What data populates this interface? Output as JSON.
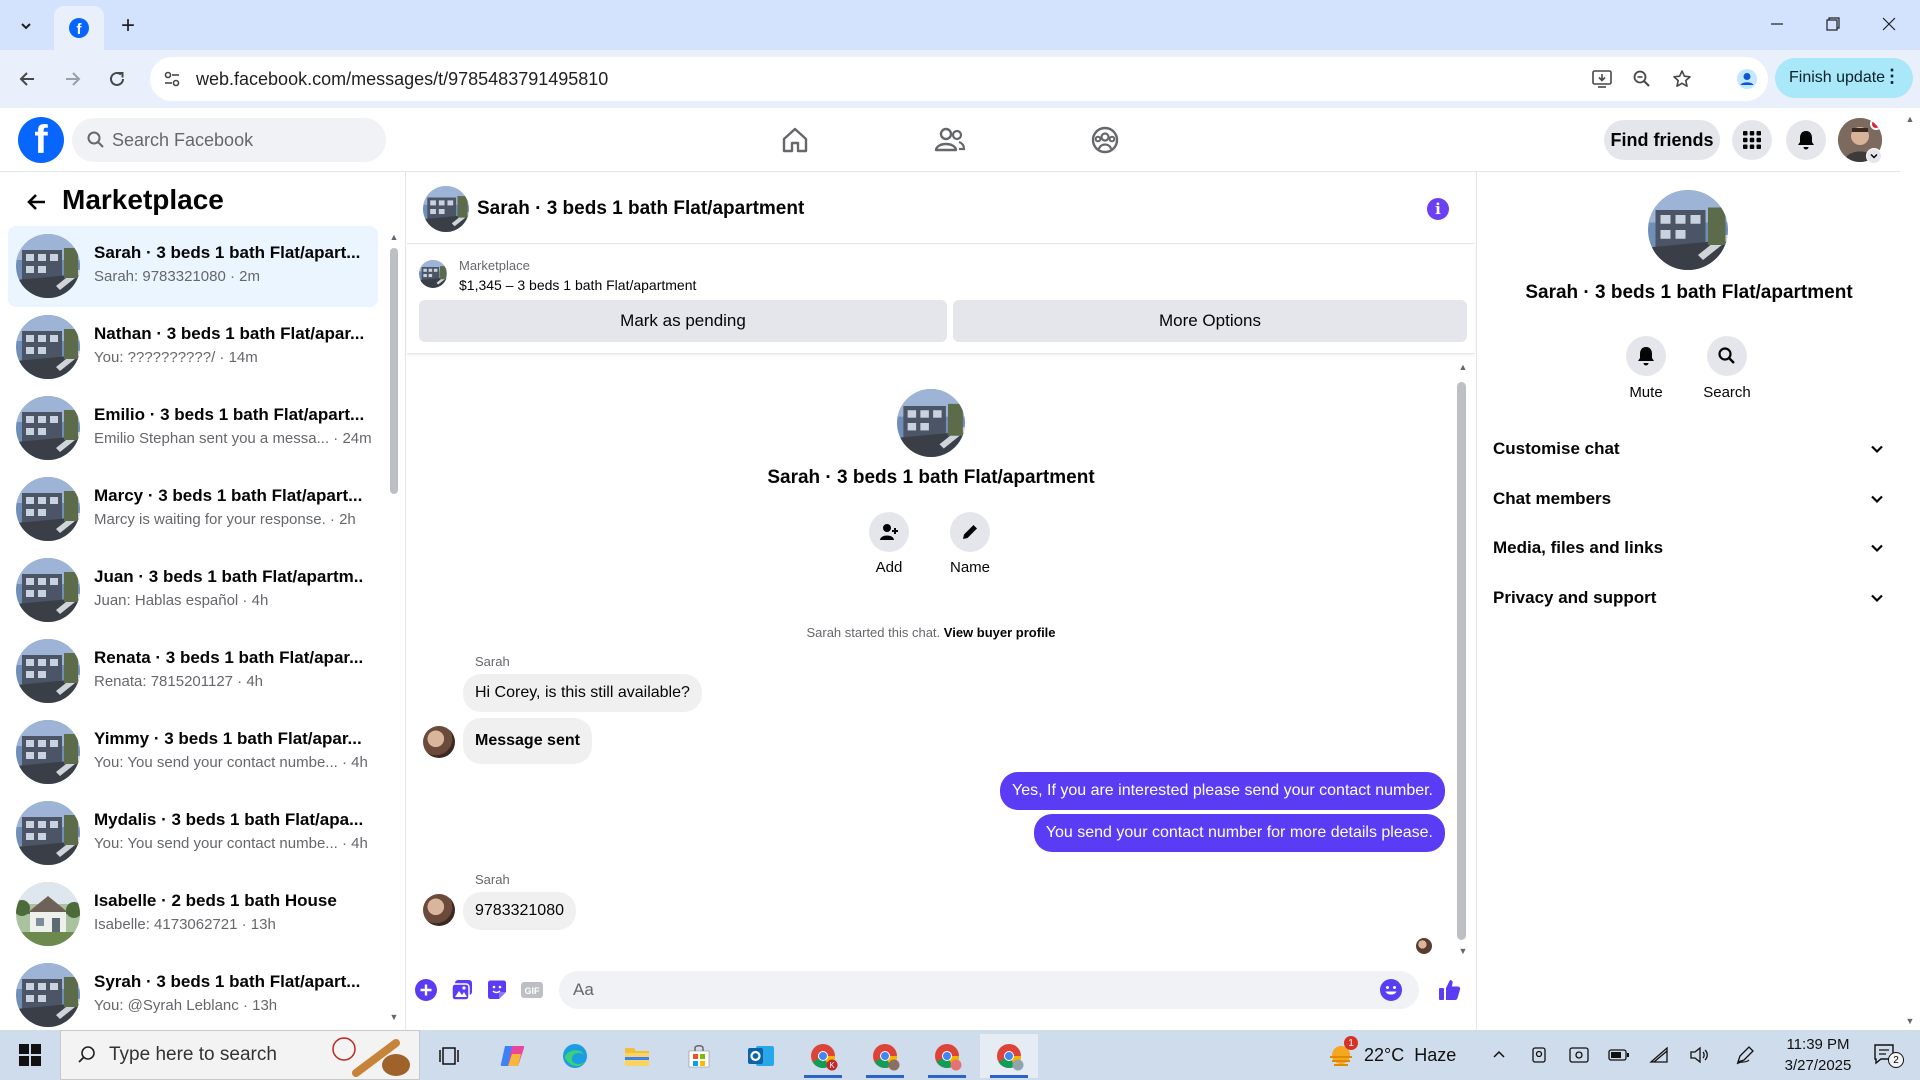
{
  "browser": {
    "url": "web.facebook.com/messages/t/9785483791495810",
    "finish_update": "Finish update",
    "colors": {
      "tabbar": "#d3e3fd",
      "toolbar": "#e9f0fb",
      "update_pill": "#a8e8f8"
    }
  },
  "fb_header": {
    "search_placeholder": "Search Facebook",
    "find_friends": "Find friends",
    "brand_color": "#0866ff"
  },
  "left_panel": {
    "title": "Marketplace",
    "chats": [
      {
        "title": "Sarah · 3 beds 1 bath Flat/apart...",
        "subtitle": "Sarah: 9783321080 · 2m",
        "thumb": "building"
      },
      {
        "title": "Nathan · 3 beds 1 bath Flat/apar...",
        "subtitle": "You: ??????????/ · 14m",
        "thumb": "building"
      },
      {
        "title": "Emilio · 3 beds 1 bath Flat/apart...",
        "subtitle": "Emilio Stephan sent you a messa... · 24m",
        "thumb": "building"
      },
      {
        "title": "Marcy · 3 beds 1 bath Flat/apart...",
        "subtitle": "Marcy is waiting for your response. · 2h",
        "thumb": "building"
      },
      {
        "title": "Juan · 3 beds 1 bath Flat/apartm...",
        "subtitle": "Juan: Hablas español · 4h",
        "thumb": "building"
      },
      {
        "title": "Renata · 3 beds 1 bath Flat/apar...",
        "subtitle": "Renata: 7815201127 · 4h",
        "thumb": "building"
      },
      {
        "title": "Yimmy · 3 beds 1 bath Flat/apar...",
        "subtitle": "You: You send your contact numbe... · 4h",
        "thumb": "building"
      },
      {
        "title": "Mydalis · 3 beds 1 bath Flat/apa...",
        "subtitle": "You: You send your contact numbe... · 4h",
        "thumb": "building"
      },
      {
        "title": "Isabelle · 2 beds 1 bath House",
        "subtitle": "Isabelle: 4173062721 · 13h",
        "thumb": "house"
      },
      {
        "title": "Syrah · 3 beds 1 bath Flat/apart...",
        "subtitle": "You: @Syrah Leblanc · 13h",
        "thumb": "building"
      }
    ]
  },
  "conversation": {
    "title": "Sarah · 3 beds 1 bath Flat/apartment",
    "listing_source": "Marketplace",
    "listing_detail": "$1,345 – 3 beds 1 bath Flat/apartment",
    "mark_pending": "Mark as pending",
    "more_options": "More Options",
    "intro_title": "Sarah · 3 beds 1 bath Flat/apartment",
    "add_label": "Add",
    "name_label": "Name",
    "started_prefix": "Sarah started this chat.",
    "view_buyer": "View buyer profile",
    "messages": [
      {
        "sender": "Sarah",
        "text": "Hi Corey, is this still available?",
        "dir": "in"
      },
      {
        "sender": "",
        "text": "Message sent",
        "dir": "in"
      },
      {
        "sender": "",
        "text": "Yes, If you are interested please send your contact number.",
        "dir": "out"
      },
      {
        "sender": "",
        "text": "You send your contact number for more details please.",
        "dir": "out"
      },
      {
        "sender": "Sarah",
        "text": "9783321080",
        "dir": "in"
      }
    ],
    "composer_placeholder": "Aa",
    "accent": "#5b3cf5"
  },
  "right_panel": {
    "title": "Sarah · 3 beds 1 bath Flat/apartment",
    "mute": "Mute",
    "search": "Search",
    "sections": [
      "Customise chat",
      "Chat members",
      "Media, files and links",
      "Privacy and support"
    ]
  },
  "taskbar": {
    "search_placeholder": "Type here to search",
    "weather": "22°C  Haze",
    "weather_badge": "1",
    "time": "11:39 PM",
    "date": "3/27/2025",
    "notification_count": "2"
  }
}
